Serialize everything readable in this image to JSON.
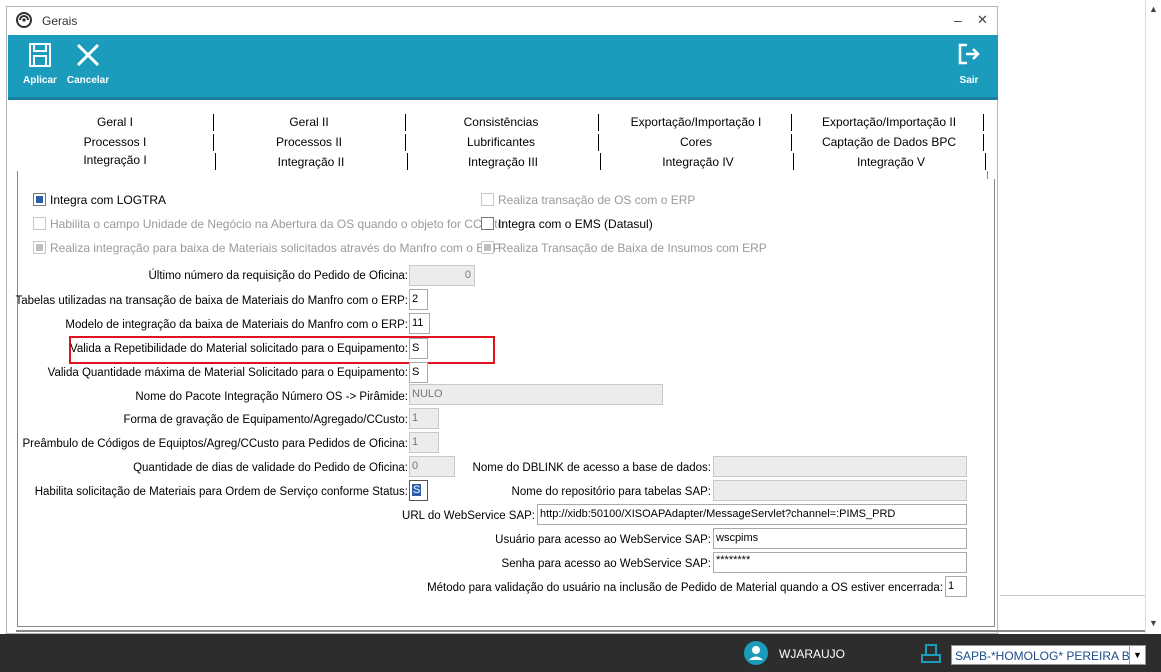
{
  "window": {
    "title": "Gerais",
    "minimize_symbol": "–",
    "close_symbol": "✕"
  },
  "toolbar": {
    "apply_label": "Aplicar",
    "cancel_label": "Cancelar",
    "exit_label": "Sair"
  },
  "tabs": {
    "row1": [
      "Geral I",
      "Geral II",
      "Consistências",
      "Exportação/Importação I",
      "Exportação/Importação II"
    ],
    "row2": [
      "Processos I",
      "Processos II",
      "Lubrificantes",
      "Cores",
      "Captação de Dados BPC"
    ],
    "row3": [
      "Integração I",
      "Integração II",
      "Integração III",
      "Integração IV",
      "Integração V"
    ]
  },
  "checkboxes": [
    {
      "label": "Integra com LOGTRA",
      "state": "checked",
      "enabled": true
    },
    {
      "label": "Habilita o campo Unidade de Negócio na Abertura da OS quando o objeto for CCusto",
      "state": "unchecked",
      "enabled": false
    },
    {
      "label": "Realiza integração para baixa de Materiais solicitados através do Manfro com o ERP",
      "state": "indeterminate",
      "enabled": false
    },
    {
      "label": "Realiza transação de OS com o ERP",
      "state": "unchecked",
      "enabled": false
    },
    {
      "label": "Integra com o EMS (Datasul)",
      "state": "unchecked",
      "enabled": true
    },
    {
      "label": "Realiza Transação de Baixa de Insumos com ERP",
      "state": "indeterminate",
      "enabled": false
    }
  ],
  "fields": [
    {
      "label": "Último número da requisição do Pedido de Oficina:",
      "value": "0"
    },
    {
      "label": "Tabelas utilizadas na transação de baixa de Materiais do Manfro com o ERP:",
      "value": "2"
    },
    {
      "label": "Modelo de integração da baixa de Materiais do Manfro com o ERP:",
      "value": "11"
    },
    {
      "label": "Valida a Repetibilidade do Material solicitado para o Equipamento:",
      "value": "S"
    },
    {
      "label": "Valida Quantidade máxima de Material Solicitado para o Equipamento:",
      "value": "S"
    },
    {
      "label": "Nome do Pacote Integração Número OS -> Pirâmide:",
      "value": "NULO"
    },
    {
      "label": "Forma de gravação de Equipamento/Agregado/CCusto:",
      "value": "1"
    },
    {
      "label": "Preâmbulo de Códigos de Equiptos/Agreg/CCusto para Pedidos de Oficina:",
      "value": "1"
    },
    {
      "label": "Quantidade de dias de validade do Pedido de Oficina:",
      "value": "0"
    },
    {
      "label": "Habilita solicitação de Materiais para Ordem de Serviço conforme Status:",
      "value": "S"
    }
  ],
  "right_fields": [
    {
      "label": "Nome do DBLINK de acesso a base de dados:",
      "value": ""
    },
    {
      "label": "Nome do repositório para tabelas SAP:",
      "value": ""
    },
    {
      "label": "URL do WebService SAP:",
      "value": "http://xidb:50100/XISOAPAdapter/MessageServlet?channel=:PIMS_PRD"
    },
    {
      "label": "Usuário para acesso ao WebService SAP:",
      "value": "wscpims"
    },
    {
      "label": "Senha para acesso ao WebService SAP:",
      "value": "********"
    },
    {
      "label": "Método para validação do usuário na inclusão de Pedido de Material quando a OS estiver encerrada:",
      "value": "1"
    }
  ],
  "highlight_color": "#e0141e",
  "toolbar_color": "#1c9cbd",
  "taskbar": {
    "user": "WJARAUJO",
    "environment": "SAPB-*HOMOLOG* PEREIRA B"
  }
}
